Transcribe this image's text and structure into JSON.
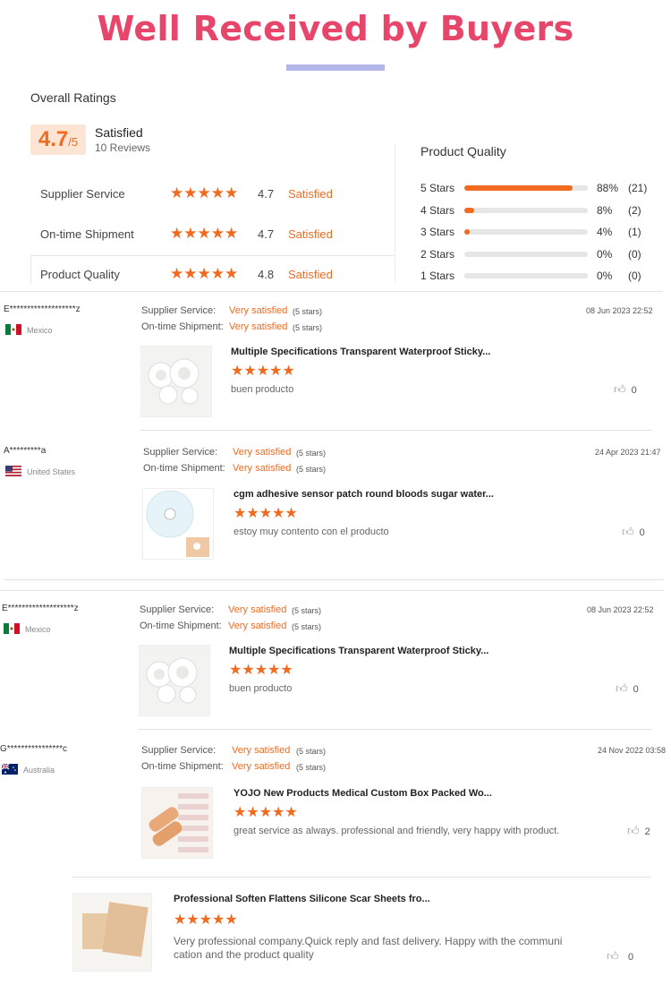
{
  "title": "Well Received by Buyers",
  "overall": {
    "heading": "Overall Ratings",
    "score": "4.7",
    "score_suffix": "/5",
    "status": "Satisfied",
    "reviews": "10 Reviews"
  },
  "ratings": [
    {
      "label": "Supplier Service",
      "value": "4.7",
      "status": "Satisfied",
      "stars": "★★★★★"
    },
    {
      "label": "On-time Shipment",
      "value": "4.7",
      "status": "Satisfied",
      "stars": "★★★★★"
    },
    {
      "label": "Product Quality",
      "value": "4.8",
      "status": "Satisfied",
      "stars": "★★★★★"
    }
  ],
  "quality": {
    "heading": "Product Quality",
    "rows": [
      {
        "label": "5  Stars",
        "pct": "88%",
        "count": "(21)",
        "fill": 0.88
      },
      {
        "label": "4  Stars",
        "pct": "8%",
        "count": "(2)",
        "fill": 0.08
      },
      {
        "label": "3  Stars",
        "pct": "4%",
        "count": "(1)",
        "fill": 0.04
      },
      {
        "label": "2  Stars",
        "pct": "0%",
        "count": "(0)",
        "fill": 0
      },
      {
        "label": "1  Stars",
        "pct": "0%",
        "count": "(0)",
        "fill": 0
      }
    ]
  },
  "meta_labels": {
    "supplier": "Supplier Service:",
    "shipment": "On-time Shipment:"
  },
  "reviews": [
    {
      "name": "E*******************z",
      "country": "Mexico",
      "supplier": "Very satisfied",
      "supplier_stars": "(5 stars)",
      "shipment": "Very satisfied",
      "shipment_stars": "(5 stars)",
      "date": "08 Jun 2023 22:52",
      "product": "Multiple Specifications Transparent Waterproof Sticky...",
      "stars": "★★★★★",
      "comment": "buen producto",
      "likes": "0"
    },
    {
      "name": "A*********a",
      "country": "United States",
      "supplier": "Very satisfied",
      "supplier_stars": "(5 stars)",
      "shipment": "Very satisfied",
      "shipment_stars": "(5 stars)",
      "date": "24 Apr 2023 21:47",
      "product": "cgm adhesive sensor patch round bloods sugar water...",
      "stars": "★★★★★",
      "comment": "estoy muy contento con el producto",
      "likes": "0"
    },
    {
      "name": "E*******************z",
      "country": "Mexico",
      "supplier": "Very satisfied",
      "supplier_stars": "(5 stars)",
      "shipment": "Very satisfied",
      "shipment_stars": "(5 stars)",
      "date": "08 Jun 2023 22:52",
      "product": "Multiple Specifications Transparent Waterproof Sticky...",
      "stars": "★★★★★",
      "comment": "buen producto",
      "likes": "0"
    },
    {
      "name": "G****************c",
      "country": "Australia",
      "supplier": "Very satisfied",
      "supplier_stars": "(5 stars)",
      "shipment": "Very satisfied",
      "shipment_stars": "(5 stars)",
      "date": "24 Nov 2022 03:58",
      "product": "YOJO New Products Medical Custom Box Packed Wo...",
      "stars": "★★★★★",
      "comment": "great service as always. professional and friendly, very happy with product.",
      "likes": "2"
    }
  ],
  "extra": {
    "product": "Professional Soften Flattens Silicone Scar Sheets fro...",
    "stars": "★★★★★",
    "comment_line1": "Very professional company.Quick reply and fast delivery. Happy with the communi",
    "comment_line2": "cation and the product quality",
    "likes": "0"
  },
  "colors": {
    "accent": "#f06a1f",
    "title": "#e8456b",
    "bar": "#b3b6ea"
  }
}
